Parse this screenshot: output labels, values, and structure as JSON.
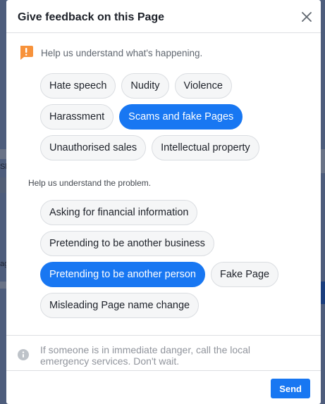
{
  "dialog": {
    "title": "Give feedback on this Page",
    "prompt": "Help us understand what's happening.",
    "categories": [
      {
        "label": "Hate speech",
        "selected": false
      },
      {
        "label": "Nudity",
        "selected": false
      },
      {
        "label": "Violence",
        "selected": false
      },
      {
        "label": "Harassment",
        "selected": false
      },
      {
        "label": "Scams and fake Pages",
        "selected": true
      },
      {
        "label": "Unauthorised sales",
        "selected": false
      },
      {
        "label": "Intellectual property",
        "selected": false
      }
    ],
    "sub_prompt": "Help us understand the problem.",
    "problems": [
      {
        "label": "Asking for financial information",
        "selected": false
      },
      {
        "label": "Pretending to be another business",
        "selected": false
      },
      {
        "label": "Pretending to be another person",
        "selected": true
      },
      {
        "label": "Fake Page",
        "selected": false
      },
      {
        "label": "Misleading Page name change",
        "selected": false
      }
    ],
    "safety_note": "If someone is in immediate danger, call the local emergency services. Don't wait.",
    "send_label": "Send"
  },
  "background": {
    "edge_letters": [
      "Sh",
      "ag"
    ]
  },
  "colors": {
    "accent": "#1877f2",
    "warning": "#f7923b",
    "chip_bg": "#f5f6f7"
  }
}
